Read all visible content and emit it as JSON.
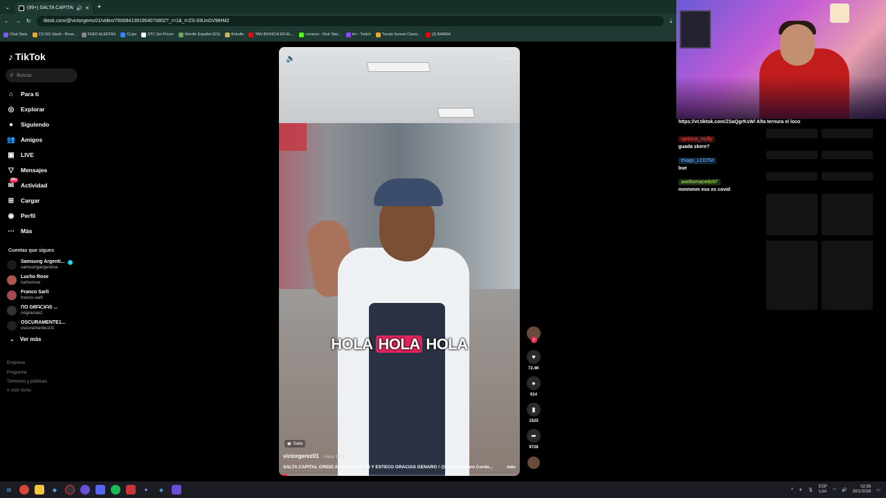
{
  "browser": {
    "tab_title": "(99+) SALTA CAPITAL GRID",
    "url": "tiktok.com/@victorgerez01/video/7600841391954070802?_r=1&_t=ZS-93UnGV9tHM2",
    "bookmarks": [
      {
        "label": "Chat Stats",
        "color": "#7b5cff"
      },
      {
        "label": "CS:GO Stash - Brow...",
        "color": "#f5a623"
      },
      {
        "label": "FEED ALERTAS",
        "color": "#888888"
      },
      {
        "label": "CLips",
        "color": "#3b82f6"
      },
      {
        "label": "STC Set Prices",
        "color": "#ffffff"
      },
      {
        "label": "Wordle Español (ES)",
        "color": "#6aaa64"
      },
      {
        "label": "Boludle",
        "color": "#c9b458"
      },
      {
        "label": "TAN BIONICA EN EL...",
        "color": "#ff0000"
      },
      {
        "label": "corraron - Kick Stat...",
        "color": "#53fc18"
      },
      {
        "label": "trrr - Twitch",
        "color": "#9146ff"
      },
      {
        "label": "Tanuki Sunset Classi...",
        "color": "#f5a623"
      },
      {
        "label": "(2) BARRA",
        "color": "#ff0000"
      }
    ]
  },
  "tiktok": {
    "logo": "TikTok",
    "search_placeholder": "Buscar",
    "nav": [
      {
        "label": "Para ti",
        "icon": "home-icon",
        "glyph": "⌂"
      },
      {
        "label": "Explorar",
        "icon": "compass-icon",
        "glyph": "◎"
      },
      {
        "label": "Siguiendo",
        "icon": "following-icon",
        "glyph": "●"
      },
      {
        "label": "Amigos",
        "icon": "friends-icon",
        "glyph": "👥"
      },
      {
        "label": "LIVE",
        "icon": "live-icon",
        "glyph": "▣"
      },
      {
        "label": "Mensajes",
        "icon": "messages-icon",
        "glyph": "▽"
      },
      {
        "label": "Actividad",
        "icon": "activity-icon",
        "glyph": "✉"
      },
      {
        "label": "Cargar",
        "icon": "upload-icon",
        "glyph": "⊞"
      },
      {
        "label": "Perfil",
        "icon": "profile-icon",
        "glyph": "◉"
      },
      {
        "label": "Más",
        "icon": "more-icon",
        "glyph": "⋯"
      }
    ],
    "activity_badge": "99+",
    "following_title": "Cuentas que sigues",
    "following": [
      {
        "name": "Samsung Argenti...",
        "handle": "samsungargentina",
        "color": "#1a1a1a"
      },
      {
        "name": "Lucho Rose",
        "handle": "luchorose",
        "color": "#b2554a"
      },
      {
        "name": "Franco Sarli",
        "handle": "franco.sarli",
        "color": "#a34a55"
      },
      {
        "name": "ᑎO GᖇᗩᑕIᗩS ...",
        "handle": "nograciasz",
        "color": "#333333"
      },
      {
        "name": "OSCURAMENTE1...",
        "handle": "oscuramente101",
        "color": "#222222"
      }
    ],
    "see_more": "Ver más",
    "footer": [
      "Empresa",
      "Programa",
      "Términos y políticas"
    ],
    "copyright": "© 2026 TikTok"
  },
  "video": {
    "caption_words": [
      "HOLA",
      "HOLA",
      "HOLA"
    ],
    "location": "Salta",
    "author": "victorgerez01",
    "posted": "· Hace 12 h",
    "description": "SALTA CAPITAL GRIDO AV SAN MARTÍN Y ESTECO GRACIAS GENARO ! @Cesar Genaro Cordo...",
    "more": "más",
    "likes": "72.4K",
    "comments": "914",
    "saves": "1525",
    "shares": "9728"
  },
  "stream": {
    "chat_link": "https://vt.tiktok.com/ZSaQgrKsW/ Alta ternura el loco",
    "messages": [
      {
        "user": "optimus_mcfly",
        "text": "guada skere?",
        "user_color": "#ff4d4d",
        "user_bg": "#3a1212"
      },
      {
        "user": "thiago_LCDTM",
        "text": "bue",
        "user_color": "#6fb7ff",
        "user_bg": "#12263a"
      },
      {
        "user": "axelitomacedo97",
        "text": "mmmmm eso es covid",
        "user_color": "#b8ff6b",
        "user_bg": "#1d2e12"
      }
    ]
  },
  "taskbar": {
    "lang_top": "ESP",
    "lang_bottom": "LAA",
    "time": "02:56",
    "date": "30/1/2026"
  }
}
